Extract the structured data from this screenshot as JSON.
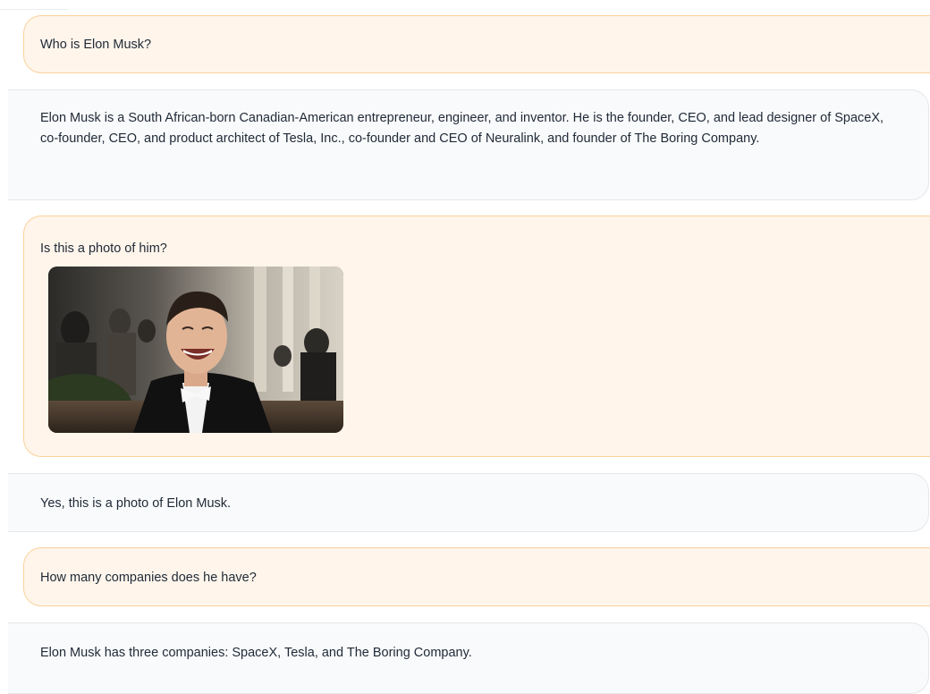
{
  "messages": [
    {
      "role": "user",
      "text": "Who is Elon Musk?"
    },
    {
      "role": "assistant",
      "text": "Elon Musk is a South African-born Canadian-American entrepreneur, engineer, and inventor. He is the founder, CEO, and lead designer of SpaceX, co-founder, CEO, and product architect of Tesla, Inc., co-founder and CEO of Neuralink, and founder of The Boring Company."
    },
    {
      "role": "user",
      "text": "Is this a photo of him?",
      "image": "photo-of-smiling-man-in-tuxedo"
    },
    {
      "role": "assistant",
      "text": "Yes, this is a photo of Elon Musk."
    },
    {
      "role": "user",
      "text": "How many companies does he have?"
    },
    {
      "role": "assistant",
      "text": "Elon Musk has three companies: SpaceX, Tesla, and The Boring Company."
    }
  ],
  "colors": {
    "user_bubble_bg": "#fff5eb",
    "user_bubble_border": "#fbd29c",
    "assistant_bubble_bg": "#f9fafb",
    "assistant_bubble_border": "#e5e7eb"
  }
}
